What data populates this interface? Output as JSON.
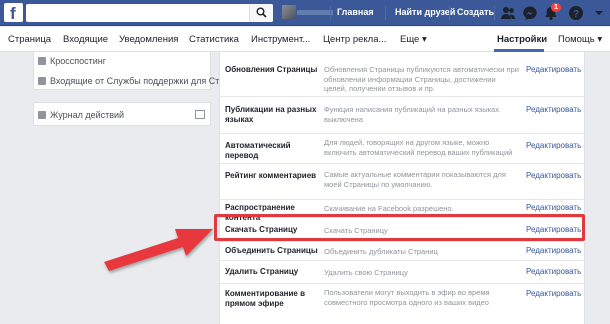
{
  "topbar": {
    "logo": "f",
    "search_placeholder": "",
    "nav": [
      "Главная",
      "Найти друзей",
      "Создать"
    ],
    "notifications_count": "1",
    "icons": [
      "friends-icon",
      "messenger-icon",
      "notifications-icon",
      "help-icon",
      "dropdown-icon"
    ]
  },
  "subnav": {
    "tabs": [
      "Страница",
      "Входящие",
      "Уведомления",
      "Статистика",
      "Инструмент...",
      "Центр рекла...",
      "Еще ▾",
      "Настройки",
      "Помощь ▾"
    ],
    "active": "Настройки"
  },
  "sidebar": {
    "items": [
      "Кросспостинг",
      "Входящие от Службы поддержки для Стр"
    ],
    "activity_log": "Журнал действий"
  },
  "settings": {
    "rows": [
      {
        "label": "Обновления Страницы",
        "desc": "Обновления Страницы публикуются автоматически при обновлении информации Страницы, достижении целей, получении отзывов и пр.",
        "edit": "Редактировать"
      },
      {
        "label": "Публикации на разных языках",
        "desc": "Функция написания публикаций на разных языках выключена",
        "edit": "Редактировать"
      },
      {
        "label": "Автоматический перевод",
        "desc": "Для людей, говорящих на другом языке, можно включить автоматический перевод ваших публикаций",
        "edit": "Редактировать"
      },
      {
        "label": "Рейтинг комментариев",
        "desc": "Самые актуальные комментарии показываются для моей Страницы по умолчанию.",
        "edit": "Редактировать"
      },
      {
        "label": "Распространение контента",
        "desc": "Скачивание на Facebook разрешено.",
        "edit": "Редактировать"
      },
      {
        "label": "Скачать Страницу",
        "desc": "Скачать Страницу",
        "edit": "Редактировать"
      },
      {
        "label": "Объединить Страницы",
        "desc": "Объединить дубликаты Страниц",
        "edit": "Редактировать"
      },
      {
        "label": "Удалить Страницу",
        "desc": "Удалить свою Страницу",
        "edit": "Редактировать"
      },
      {
        "label": "Комментирование в прямом эфире",
        "desc": "Пользователи могут выходить в эфир во время совместного просмотра одного из ваших видео",
        "edit": "Редактировать"
      }
    ]
  },
  "colors": {
    "brand": "#3b5998",
    "highlight": "#e0393e",
    "link": "#365899"
  }
}
